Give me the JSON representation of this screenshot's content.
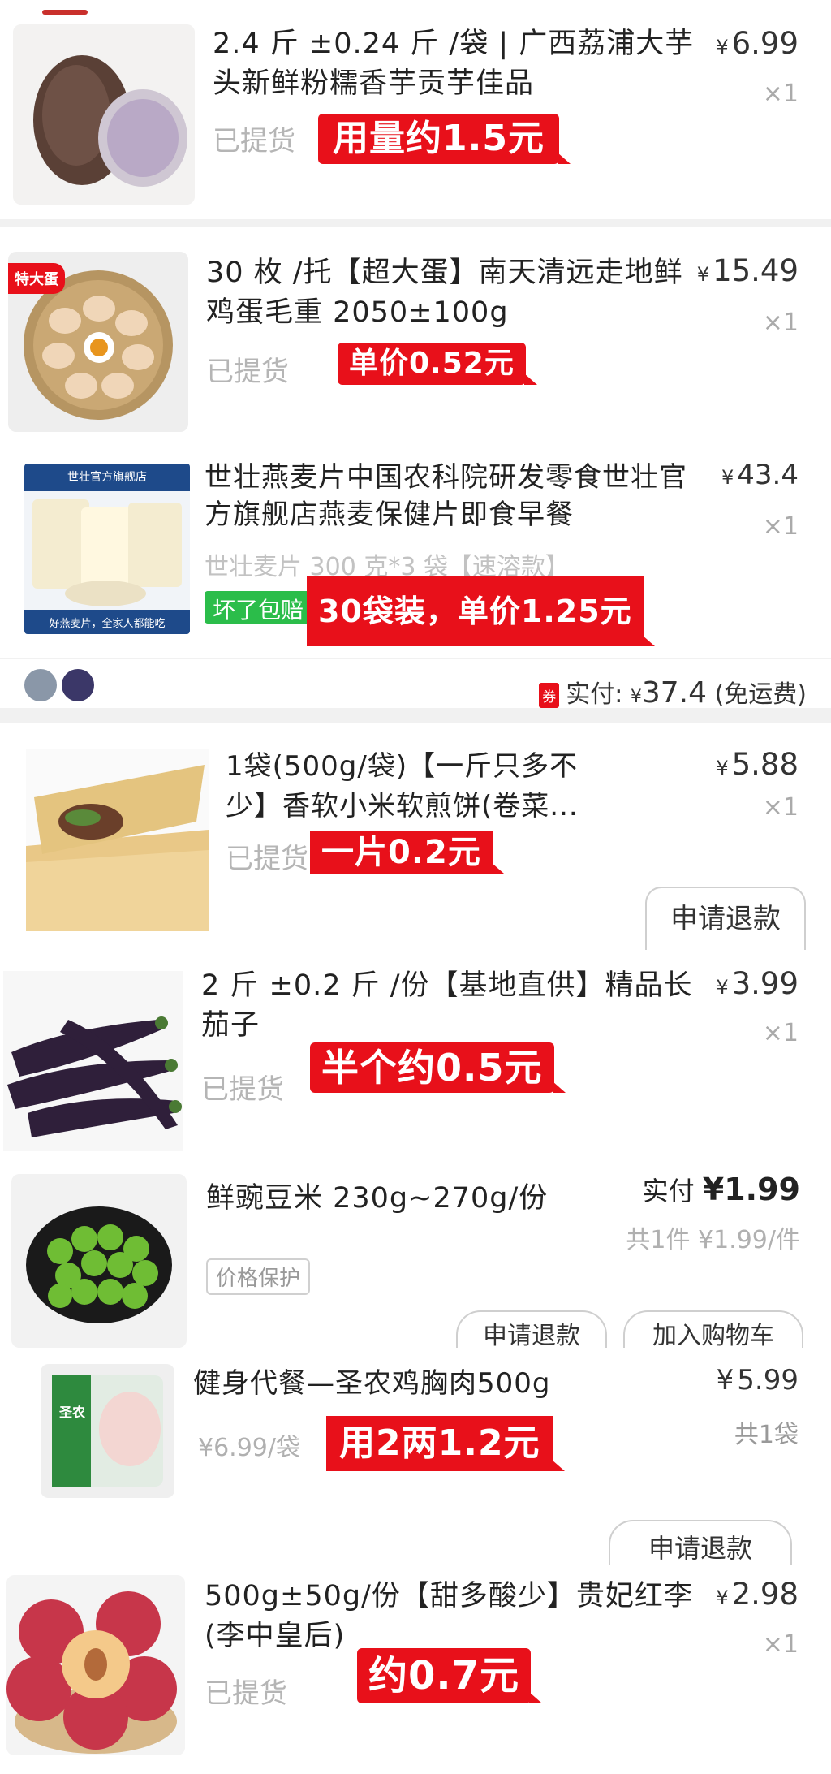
{
  "items": [
    {
      "title": "2.4 斤 ±0.24 斤 /袋 | 广西荔浦大芋头新鲜粉糯香芋贡芋佳品",
      "price": "6.99",
      "qty": "×1",
      "status": "已提货",
      "sticker": "用量约1.5元",
      "icon": "taro-image"
    },
    {
      "badge": "特大蛋",
      "title": "30 枚 /托【超大蛋】南天清远走地鲜鸡蛋毛重 2050±100g",
      "price": "15.49",
      "qty": "×1",
      "status": "已提货",
      "sticker": "单价0.52元",
      "icon": "eggs-image"
    },
    {
      "title": "世壮燕麦片中国农科院研发零食世壮官方旗舰店燕麦保健片即食早餐",
      "sku": "世壮麦片 300 克*3 袋【速溶款】",
      "tag": "坏了包赔",
      "price": "43.4",
      "qty": "×1",
      "sticker": "30袋装，单价1.25元",
      "icon": "oatmeal-image",
      "store_banner": "世壮官方旗舰店",
      "store_footer": "好燕麦片，全家人都能吃"
    },
    {
      "title": "1袋(500g/袋)【一斤只多不少】香软小米软煎饼(卷菜...",
      "price": "5.88",
      "qty": "×1",
      "status": "已提货",
      "sticker": "一片0.2元",
      "button": "申请退款",
      "icon": "pancake-image"
    },
    {
      "title": "2 斤 ±0.2 斤 /份【基地直供】精品长茄子",
      "price": "3.99",
      "qty": "×1",
      "status": "已提货",
      "sticker": "半个约0.5元",
      "icon": "eggplant-image"
    },
    {
      "title": "鲜豌豆米 230g~270g/份",
      "paid_label": "实付",
      "price": "1.99",
      "summary": "共1件 ¥1.99/件",
      "tag": "价格保护",
      "buttons": [
        "申请退款",
        "加入购物车"
      ],
      "icon": "peas-image"
    },
    {
      "title": "健身代餐—圣农鸡胸肉500g",
      "price": "5.99",
      "qty": "共1袋",
      "orig_price": "¥6.99/袋",
      "sticker": "用2两1.2元",
      "button": "申请退款",
      "icon": "chicken-breast-image",
      "pkg_brand": "圣农"
    },
    {
      "title": "500g±50g/份【甜多酸少】贵妃红李(李中皇后)",
      "price": "2.98",
      "qty": "×1",
      "status": "已提货",
      "sticker": "约0.7元",
      "icon": "plum-image"
    }
  ],
  "order_footer": {
    "coupon": "券",
    "paid_label": "实付:",
    "currency": "¥",
    "amount": "37.4",
    "shipping": "(免运费)"
  },
  "currency": "¥",
  "colors": {
    "sticker": "#e8101a",
    "tag_green": "#2bbd4a"
  }
}
